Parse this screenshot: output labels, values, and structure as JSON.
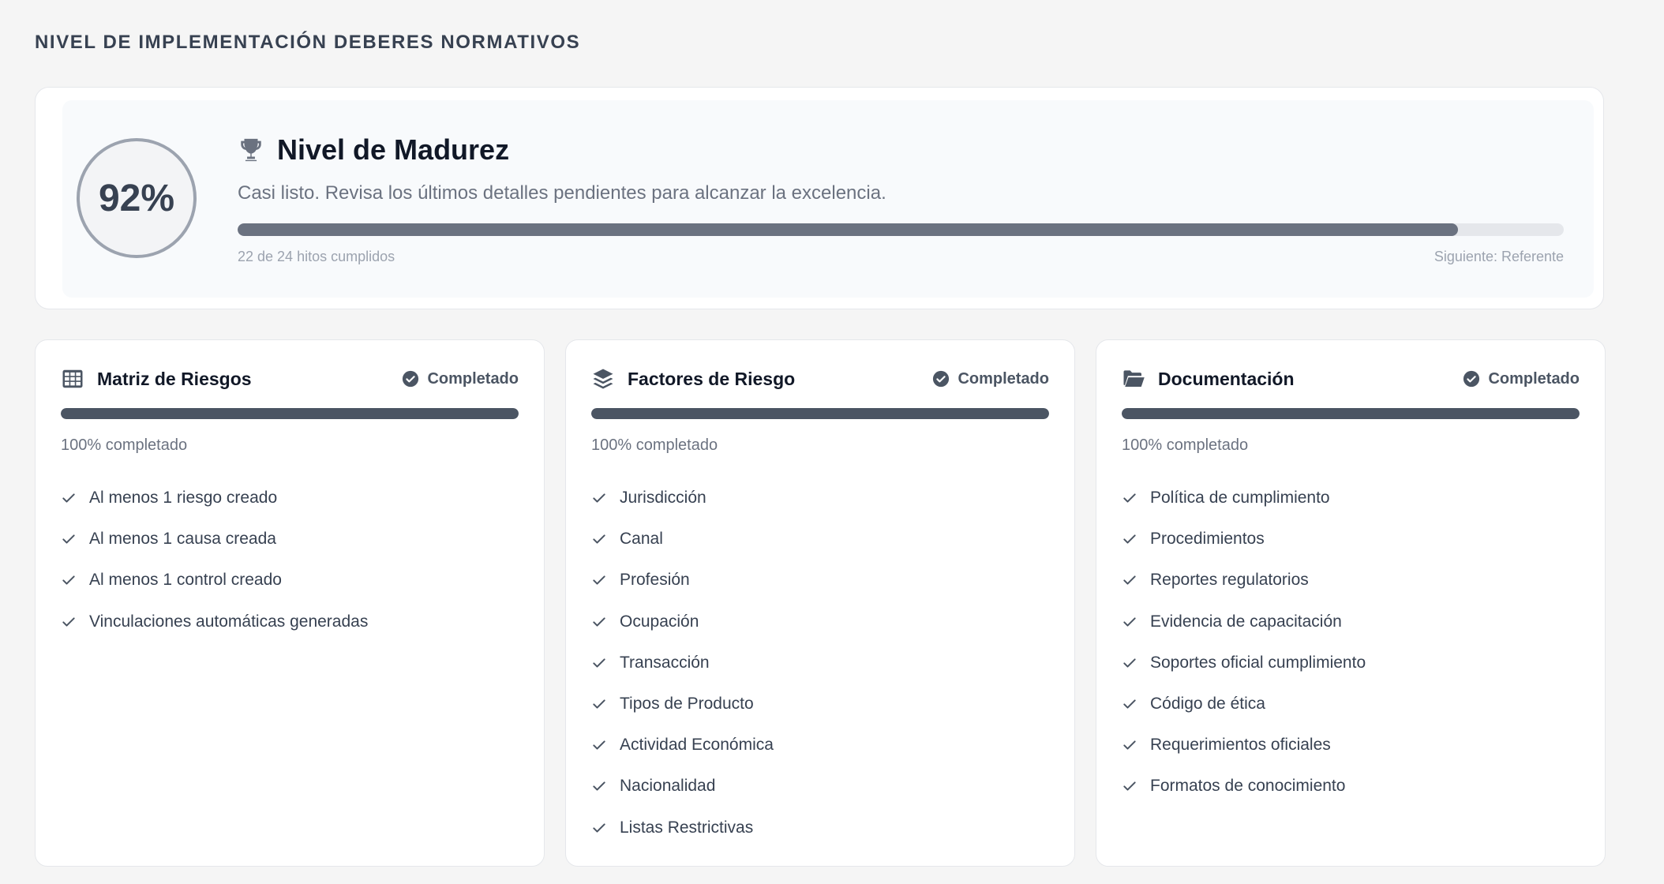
{
  "page": {
    "title": "NIVEL DE IMPLEMENTACIÓN DEBERES NORMATIVOS"
  },
  "maturity": {
    "percent_label": "92%",
    "progress": 0.92,
    "icon": "trophy-icon",
    "title": "Nivel de Madurez",
    "description": "Casi listo. Revisa los últimos detalles pendientes para alcanzar la excelencia.",
    "milestones_text": "22 de 24 hitos cumplidos",
    "next_text": "Siguiente: Referente"
  },
  "cards": [
    {
      "icon": "table-grid-icon",
      "title": "Matriz de Riesgos",
      "status": "Completado",
      "progress": 1.0,
      "percent_text": "100% completado",
      "items": [
        "Al menos 1 riesgo creado",
        "Al menos 1 causa creada",
        "Al menos 1 control creado",
        "Vinculaciones automáticas generadas"
      ]
    },
    {
      "icon": "layers-icon",
      "title": "Factores de Riesgo",
      "status": "Completado",
      "progress": 1.0,
      "percent_text": "100% completado",
      "items": [
        "Jurisdicción",
        "Canal",
        "Profesión",
        "Ocupación",
        "Transacción",
        "Tipos de Producto",
        "Actividad Económica",
        "Nacionalidad",
        "Listas Restrictivas"
      ]
    },
    {
      "icon": "folder-open-icon",
      "title": "Documentación",
      "status": "Completado",
      "progress": 1.0,
      "percent_text": "100% completado",
      "items": [
        "Política de cumplimiento",
        "Procedimientos",
        "Reportes regulatorios",
        "Evidencia de capacitación",
        "Soportes oficial cumplimiento",
        "Código de ética",
        "Requerimientos oficiales",
        "Formatos de conocimiento"
      ]
    }
  ],
  "colors": {
    "accent": "#4b5563",
    "bar_track": "#e5e7eb",
    "maturity_fill": "#6b7280"
  }
}
